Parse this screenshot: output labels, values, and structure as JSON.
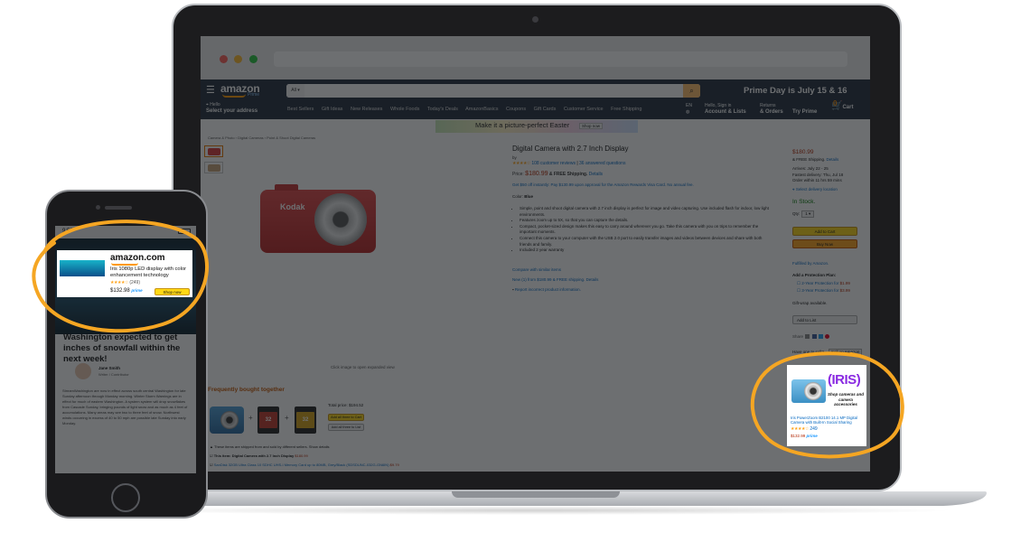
{
  "browser": {
    "header": {
      "logo": "amazon",
      "logo_sub": "Prime",
      "search_category": "All",
      "promo": "Prime Day is July 15 & 16",
      "deliver_small": "Hello",
      "deliver_main": "Select your address",
      "nav_links": [
        "Best Sellers",
        "Gift Ideas",
        "New Releases",
        "Whole Foods",
        "Today's Deals",
        "AmazonBasics",
        "Coupons",
        "Gift Cards",
        "Customer Service",
        "Free Shipping"
      ],
      "lang": "EN",
      "account_small": "Hello, Sign in",
      "account_main": "Account & Lists",
      "orders_small": "Returns",
      "orders_main": "& Orders",
      "prime_main": "Try Prime",
      "cart_label": "Cart",
      "cart_count": "0"
    },
    "banner": {
      "text": "Make it a picture-perfect Easter",
      "shop": "Shop now"
    },
    "breadcrumb": "Camera & Photo › Digital Cameras › Point & Shoot Digital Cameras",
    "product": {
      "title": "Digital Camera with 2.7 Inch Display",
      "by": "by",
      "stars": "★★★★☆",
      "ratings": "108 customer reviews",
      "answered": "36 answered questions",
      "price_label": "Price:",
      "price": "$180.99",
      "free_shipping": "& FREE Shipping.",
      "details": "Details",
      "promo": "Get $50 off instantly: Pay $130.99 upon approval for the Amazon Rewards Visa Card. No annual fee.",
      "color_label": "Color:",
      "color": "Blue",
      "bullets": [
        "Simple, point and shoot digital camera with 2.7 inch display is perfect for image and video capturing. Use included flash for indoor, low light environments.",
        "Features zoom up to 5X, so that you can capture the details.",
        "Compact, pocket-sized design makes this easy to carry around wherever you go. Take this camera with you on trips to remember the important moments.",
        "Connect this camera to your computer with the USB 2.0 port to easily transfer images and videos between devices and share with both friends and family.",
        "Included 2 year warranty"
      ],
      "compare": "Compare with similar items",
      "new_from": "New (1) from $180.99 & FREE shipping.",
      "new_details": "Details",
      "report": "Report incorrect product information.",
      "camera_brand": "Kodak",
      "click_hint": "Click image to open expanded view"
    },
    "buybox": {
      "price": "$180.99",
      "ship": "& FREE Shipping.",
      "ship_details": "Details",
      "arrives": "Arrives: July 22 - 25",
      "fastest": "Fastest delivery: Thu, Jul 18",
      "order_within": "Order within 11 hrs 59 mins",
      "select_location": "Select delivery location",
      "in_stock": "In Stock.",
      "qty_label": "Qty:",
      "qty": "1",
      "add_to_cart": "Add to Cart",
      "buy_now": "Buy Now",
      "fulfilled": "Fulfilled by Amazon.",
      "protection_title": "Add a Protection Plan:",
      "protection": [
        {
          "label": "2-Year Protection for",
          "price": "$1.99"
        },
        {
          "label": "3-Year Protection for",
          "price": "$3.99"
        }
      ],
      "gift_wrap": "Gift-wrap available.",
      "add_to_list": "Add to List",
      "share": "Share",
      "sell_text": "Have one to sell?",
      "sell_button": "Sell on Amazon"
    },
    "fbt": {
      "title": "Frequently bought together",
      "sd1": "32",
      "sd2": "32",
      "total": "Total price: $194.52",
      "add_all": "Add all three to Cart",
      "add_list": "Add all three to List",
      "note": "These items are shipped from and sold by different sellers. Show details",
      "item1": "This item: Digital Camera with 2.7 Inch Display",
      "item1_price": "$180.99",
      "item2": "SanDisk 32GB Ultra Class 10 SDHC UHS-I Memory Card up to 80MB, Grey/Black (SDSDUNC-032G-GN6IN)",
      "item2_price": "$9.79"
    },
    "sponsored_ad": {
      "logo": "IRIS",
      "tagline": "Shop cameras and camera accessories",
      "title": "Iris PowerZoom B2100 14.1 MP Digital Camera with Built-In Social Sharing",
      "stars": "★★★★☆",
      "count": "249",
      "price": "$132.99",
      "prime": "prime"
    }
  },
  "phone": {
    "time": "9:50",
    "ad": {
      "logo": "amazon.com",
      "title": "Iris 1080p LED display with color enhancement technology",
      "stars": "★★★★☆",
      "count": "(249)",
      "price": "$132.98",
      "prime": "prime",
      "cta": "Shop now"
    },
    "article": {
      "headline": "Washington expected to get inches of snowfall within the next week!",
      "author_name": "Jane Smith",
      "author_role": "Writer / Contributor",
      "body": "StreamWashington are now in effect across south central Washington for late Sunday afternoon through Monday morning. Winter Storm Warnings are in effect for much of eastern Washington. A system system will drop snowflakes from Cascade Sunday, bringing pounds of light snow and as much as 4 feet of accumulations. Many areas may see two to three feet of snow. Northwest winds occurring in excess of 40 to 50 mph are possible late Sunday into early Monday."
    }
  },
  "colors": {
    "highlight": "#f5a623",
    "amazon_dark": "#232f3e",
    "amazon_orange": "#ff9900"
  }
}
